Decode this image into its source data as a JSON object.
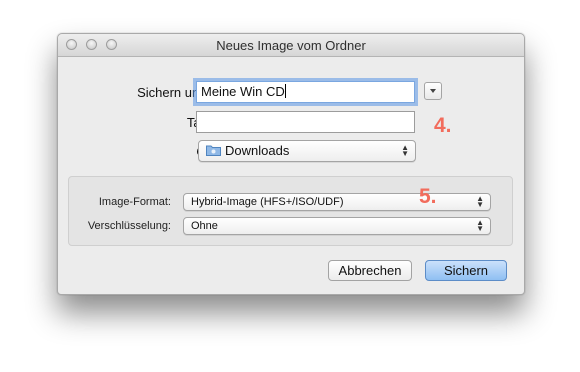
{
  "window": {
    "title": "Neues Image vom Ordner"
  },
  "form": {
    "save_as_label": "Sichern unter:",
    "save_as_value": "Meine Win CD",
    "tags_label": "Tags:",
    "tags_value": "",
    "location_label": "Ort:",
    "location_value": "Downloads",
    "image_format_label": "Image-Format:",
    "image_format_value": "Hybrid-Image (HFS+/ISO/UDF)",
    "encryption_label": "Verschlüsselung:",
    "encryption_value": "Ohne"
  },
  "buttons": {
    "cancel": "Abbrechen",
    "save": "Sichern"
  },
  "annotations": {
    "step4": "4.",
    "step5": "5."
  },
  "icons": [
    "close-light",
    "minimize-light",
    "zoom-light",
    "disclosure-arrow",
    "folder-icon",
    "popup-arrows"
  ]
}
